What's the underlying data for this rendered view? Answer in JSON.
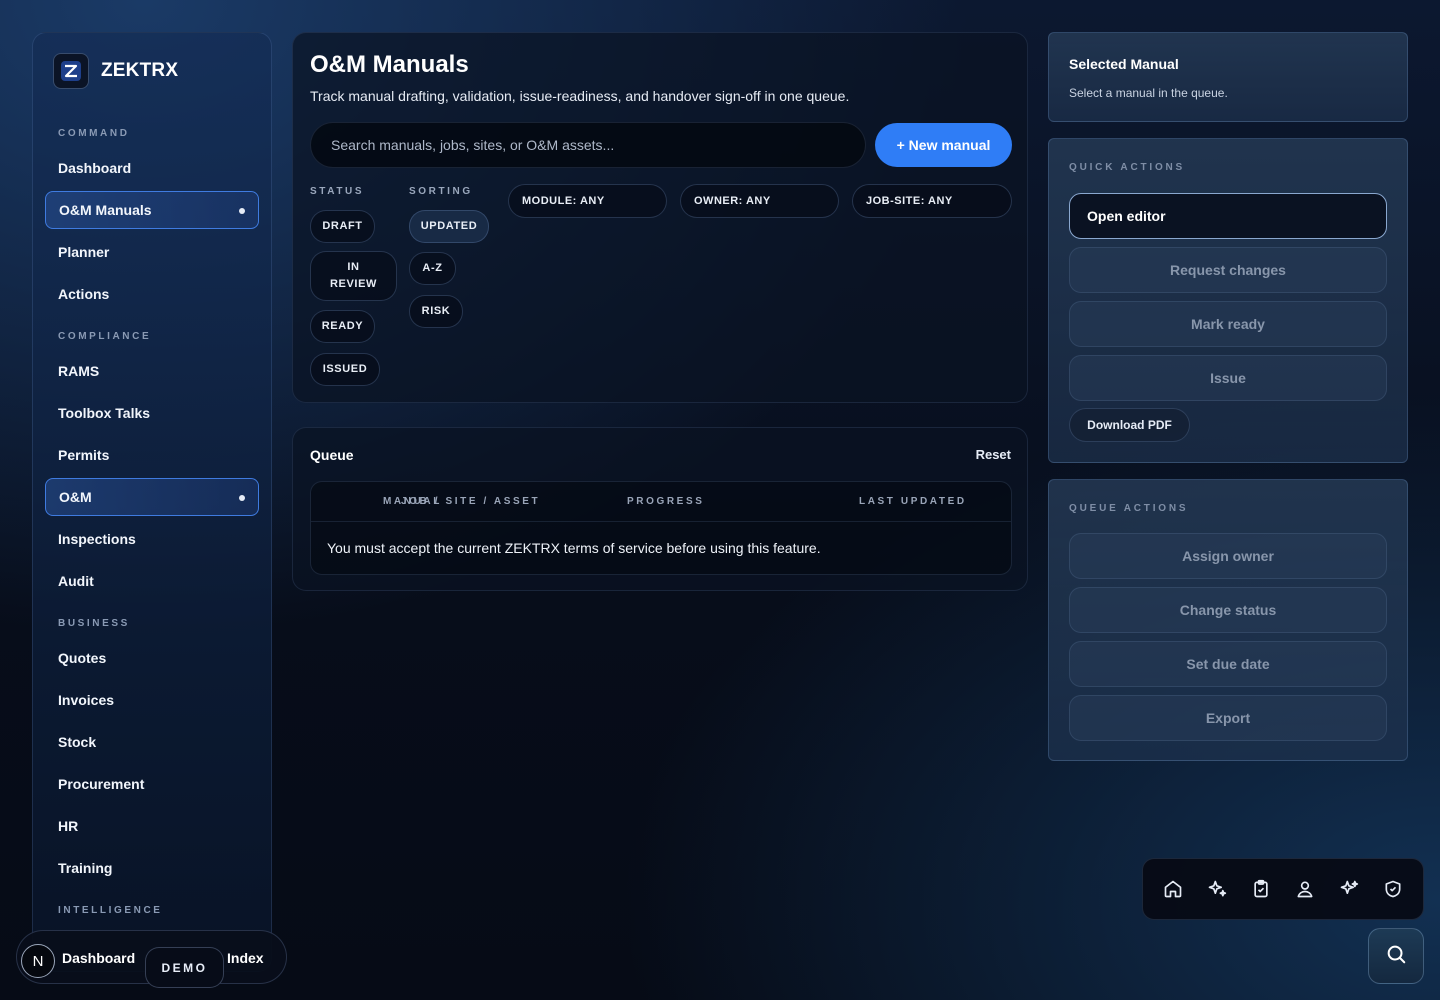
{
  "brand": {
    "name": "ZEKTRX"
  },
  "sidebar": {
    "sections": [
      {
        "label": "COMMAND"
      },
      {
        "label": "COMPLIANCE"
      },
      {
        "label": "BUSINESS"
      },
      {
        "label": "INTELLIGENCE"
      }
    ],
    "items": [
      {
        "label": "Dashboard",
        "active": false
      },
      {
        "label": "O&M Manuals",
        "active": true
      },
      {
        "label": "Planner",
        "active": false
      },
      {
        "label": "Actions",
        "active": false
      },
      {
        "label": "RAMS",
        "active": false
      },
      {
        "label": "Toolbox Talks",
        "active": false
      },
      {
        "label": "Permits",
        "active": false
      },
      {
        "label": "O&M",
        "active": true
      },
      {
        "label": "Inspections",
        "active": false
      },
      {
        "label": "Audit",
        "active": false
      },
      {
        "label": "Quotes",
        "active": false
      },
      {
        "label": "Invoices",
        "active": false
      },
      {
        "label": "Stock",
        "active": false
      },
      {
        "label": "Procurement",
        "active": false
      },
      {
        "label": "HR",
        "active": false
      },
      {
        "label": "Training",
        "active": false
      }
    ]
  },
  "bottom_bar": {
    "badge": "N",
    "dashboard_label": "Dashboard",
    "demo_label": "DEMO",
    "index_label": "Index"
  },
  "header": {
    "title": "O&M Manuals",
    "subtitle": "Track manual drafting, validation, issue-readiness, and handover sign-off in one queue.",
    "search_placeholder": "Search manuals, jobs, sites, or O&M assets...",
    "new_button": "+ New manual"
  },
  "filters": {
    "status_label": "STATUS",
    "sorting_label": "SORTING",
    "status_options": [
      "DRAFT",
      "IN REVIEW",
      "READY",
      "ISSUED"
    ],
    "sorting_options": [
      "UPDATED",
      "A-Z",
      "RISK"
    ],
    "sorting_selected": "UPDATED",
    "module": "MODULE: ANY",
    "owner": "OWNER: ANY",
    "job_site": "JOB-SITE: ANY"
  },
  "queue": {
    "title": "Queue",
    "reset_label": "Reset",
    "columns": [
      "MANUAL",
      "JOB / SITE / ASSET",
      "PROGRESS",
      "LAST UPDATED"
    ],
    "message": "You must accept the current ZEKTRX terms of service before using this feature."
  },
  "selected": {
    "title": "Selected Manual",
    "subtitle": "Select a manual in the queue."
  },
  "quick_actions": {
    "label": "QUICK ACTIONS",
    "open_editor": "Open editor",
    "request_changes": "Request changes",
    "mark_ready": "Mark ready",
    "issue": "Issue",
    "download_pdf": "Download PDF"
  },
  "queue_actions": {
    "label": "QUEUE ACTIONS",
    "assign_owner": "Assign owner",
    "change_status": "Change status",
    "set_due_date": "Set due date",
    "export": "Export"
  },
  "dock": {
    "icons": [
      "home-icon",
      "sparkles-icon",
      "clipboard-check-icon",
      "user-icon",
      "sparkles-icon",
      "shield-check-icon"
    ]
  },
  "fab": {
    "icon": "search-icon"
  },
  "colors": {
    "accent": "#2f7df6",
    "active_border": "#3f7be0"
  }
}
